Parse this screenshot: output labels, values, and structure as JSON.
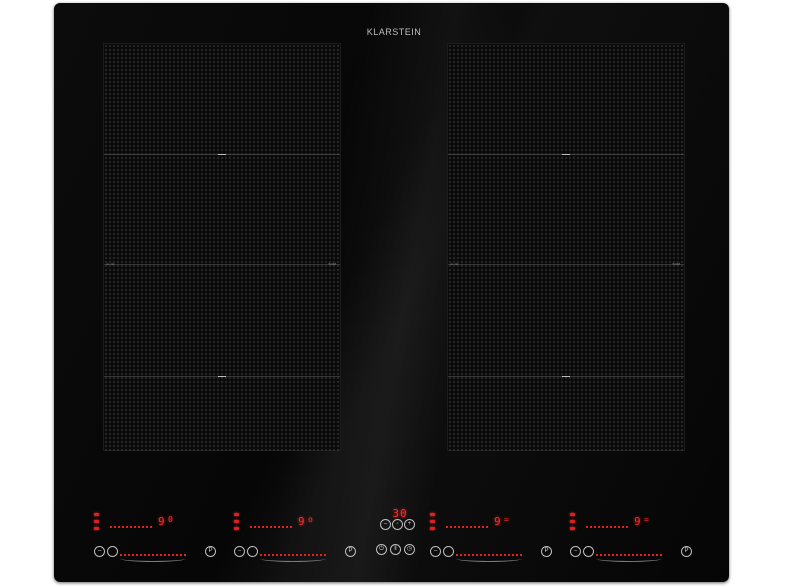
{
  "product": {
    "brand": "KLARSTEIN"
  },
  "zones": {
    "left": {
      "label_left": "cm 44",
      "label_right": "50/48"
    },
    "right": {
      "label_left": "cm 44",
      "label_right": "50/48"
    }
  },
  "controls": {
    "timer_display": "30",
    "burners": [
      {
        "display": "9",
        "suffix": "0"
      },
      {
        "display": "9",
        "suffix": "o"
      },
      {
        "display": "9",
        "suffix": "="
      },
      {
        "display": "9",
        "suffix": "="
      }
    ]
  },
  "colors": {
    "glass": "#070707",
    "led_red": "#ff2a2a",
    "grid_dot": "#7a7a7a",
    "brand_text": "#bdbdbd"
  },
  "icons": {
    "power": "power-icon",
    "plus": "plus-icon",
    "minus": "minus-icon",
    "lock": "lock-icon",
    "pause": "pause-icon",
    "boost": "boost-icon"
  }
}
